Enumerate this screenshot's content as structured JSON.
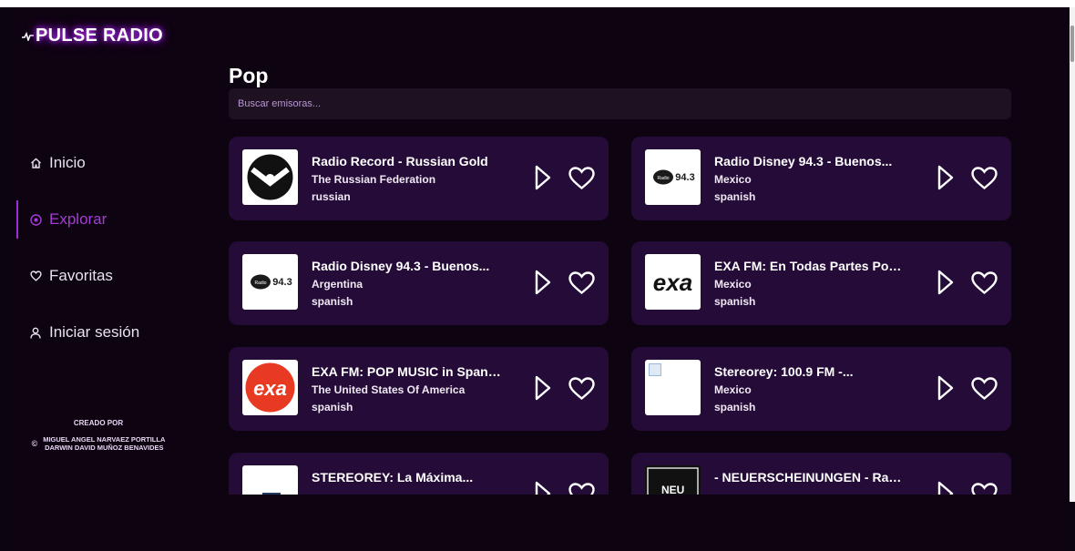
{
  "app": {
    "logo_text": "PULSE RADIO",
    "logo_icon": "pulse-icon",
    "accent": "#a53bd6"
  },
  "sidebar": {
    "items": [
      {
        "label": "Inicio",
        "icon": "home-icon",
        "active": false
      },
      {
        "label": "Explorar",
        "icon": "compass-icon",
        "active": true
      },
      {
        "label": "Favoritas",
        "icon": "heart-icon",
        "active": false
      },
      {
        "label": "Iniciar sesión",
        "icon": "user-icon",
        "active": false
      }
    ],
    "credits": {
      "title": "CREADO POR",
      "copyright": "©",
      "name1": "MIGUEL ANGEL NARVAEZ PORTILLA",
      "name2": "DARWIN DAVID MUÑOZ BENAVIDES"
    }
  },
  "main": {
    "title": "Pop",
    "search": {
      "placeholder": "Buscar emisoras...",
      "value": ""
    },
    "stations": [
      {
        "name": "Radio Record - Russian Gold",
        "country": "The Russian Federation",
        "language": "russian",
        "logo": "record-logo"
      },
      {
        "name": "Radio Disney 94.3 - Buenos...",
        "country": "Mexico",
        "language": "spanish",
        "logo": "disney-logo"
      },
      {
        "name": "Radio Disney 94.3 - Buenos...",
        "country": "Argentina",
        "language": "spanish",
        "logo": "disney-logo"
      },
      {
        "name": "EXA FM: En Todas Partes Pont...",
        "country": "Mexico",
        "language": "spanish",
        "logo": "exa-logo-black"
      },
      {
        "name": "EXA FM: POP MUSIC in Spanis...",
        "country": "The United States Of America",
        "language": "spanish",
        "logo": "exa-logo-red"
      },
      {
        "name": "Stereorey: 100.9 FM -...",
        "country": "Mexico",
        "language": "spanish",
        "logo": "broken-image"
      },
      {
        "name": "STEREOREY: La Máxima...",
        "country": "",
        "language": "",
        "logo": "stereorey-logo"
      },
      {
        "name": "- NEUERSCHEINUNGEN - Radi...",
        "country": "",
        "language": "",
        "logo": "neu-logo"
      }
    ]
  }
}
